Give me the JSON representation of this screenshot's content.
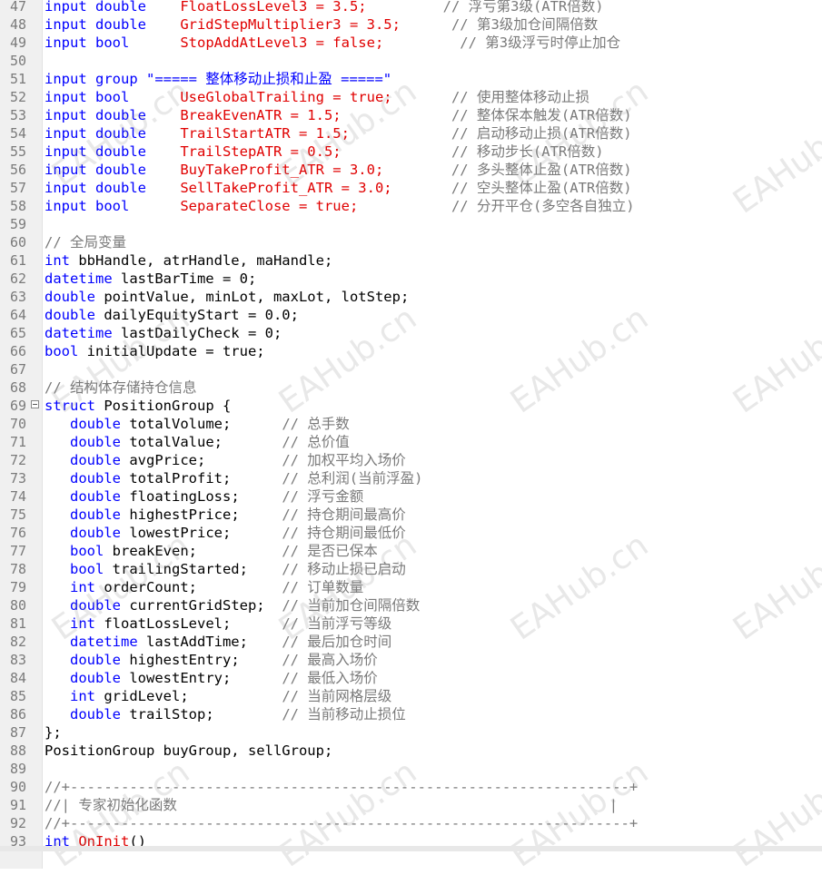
{
  "lines": [
    {
      "n": "47",
      "t": [
        [
          "kw",
          "input double"
        ],
        [
          "",
          "    "
        ],
        [
          "red",
          "FloatLossLevel3"
        ],
        [
          "",
          ""
        ],
        [
          "red",
          " = 3.5;"
        ],
        [
          "",
          ""
        ],
        [
          "cm",
          "         // 浮亏第3级(ATR倍数)"
        ]
      ]
    },
    {
      "n": "48",
      "t": [
        [
          "kw",
          "input double"
        ],
        [
          "",
          "    "
        ],
        [
          "red",
          "GridStepMultiplier3 = 3.5;"
        ],
        [
          "cm",
          "      // 第3级加仓间隔倍数"
        ]
      ]
    },
    {
      "n": "49",
      "t": [
        [
          "kw",
          "input bool"
        ],
        [
          "",
          "      "
        ],
        [
          "red",
          "StopAddAtLevel3 = false;"
        ],
        [
          "cm",
          "         // 第3级浮亏时停止加仓"
        ]
      ]
    },
    {
      "n": "50",
      "t": []
    },
    {
      "n": "51",
      "t": [
        [
          "kw",
          "input group "
        ],
        [
          "str",
          "\"===== 整体移动止损和止盈 =====\""
        ]
      ]
    },
    {
      "n": "52",
      "t": [
        [
          "kw",
          "input bool"
        ],
        [
          "",
          "      "
        ],
        [
          "red",
          "UseGlobalTrailing = true;"
        ],
        [
          "cm",
          "       // 使用整体移动止损"
        ]
      ]
    },
    {
      "n": "53",
      "t": [
        [
          "kw",
          "input double"
        ],
        [
          "",
          "    "
        ],
        [
          "red",
          "BreakEvenATR = 1.5;"
        ],
        [
          "cm",
          "             // 整体保本触发(ATR倍数)"
        ]
      ]
    },
    {
      "n": "54",
      "t": [
        [
          "kw",
          "input double"
        ],
        [
          "",
          "    "
        ],
        [
          "red",
          "TrailStartATR = 1.5;"
        ],
        [
          "cm",
          "            // 启动移动止损(ATR倍数)"
        ]
      ]
    },
    {
      "n": "55",
      "t": [
        [
          "kw",
          "input double"
        ],
        [
          "",
          "    "
        ],
        [
          "red",
          "TrailStepATR = 0.5;"
        ],
        [
          "cm",
          "             // 移动步长(ATR倍数)"
        ]
      ]
    },
    {
      "n": "56",
      "t": [
        [
          "kw",
          "input double"
        ],
        [
          "",
          "    "
        ],
        [
          "red",
          "BuyTakeProfit_ATR = 3.0;"
        ],
        [
          "cm",
          "        // 多头整体止盈(ATR倍数)"
        ]
      ]
    },
    {
      "n": "57",
      "t": [
        [
          "kw",
          "input double"
        ],
        [
          "",
          "    "
        ],
        [
          "red",
          "SellTakeProfit_ATR = 3.0;"
        ],
        [
          "cm",
          "       // 空头整体止盈(ATR倍数)"
        ]
      ]
    },
    {
      "n": "58",
      "t": [
        [
          "kw",
          "input bool"
        ],
        [
          "",
          "      "
        ],
        [
          "red",
          "SeparateClose = true;"
        ],
        [
          "cm",
          "           // 分开平仓(多空各自独立)"
        ]
      ]
    },
    {
      "n": "59",
      "t": []
    },
    {
      "n": "60",
      "t": [
        [
          "cm",
          "// 全局变量"
        ]
      ]
    },
    {
      "n": "61",
      "t": [
        [
          "kw",
          "int"
        ],
        [
          "",
          " bbHandle, atrHandle, maHandle;"
        ]
      ]
    },
    {
      "n": "62",
      "t": [
        [
          "kw",
          "datetime"
        ],
        [
          "",
          " lastBarTime = 0;"
        ]
      ]
    },
    {
      "n": "63",
      "t": [
        [
          "kw",
          "double"
        ],
        [
          "",
          " pointValue, minLot, maxLot, lotStep;"
        ]
      ]
    },
    {
      "n": "64",
      "t": [
        [
          "kw",
          "double"
        ],
        [
          "",
          " dailyEquityStart = 0.0;"
        ]
      ]
    },
    {
      "n": "65",
      "t": [
        [
          "kw",
          "datetime"
        ],
        [
          "",
          " lastDailyCheck = 0;"
        ]
      ]
    },
    {
      "n": "66",
      "t": [
        [
          "kw",
          "bool"
        ],
        [
          "",
          " initialUpdate = true;"
        ]
      ]
    },
    {
      "n": "67",
      "t": []
    },
    {
      "n": "68",
      "t": [
        [
          "cm",
          "// 结构体存储持仓信息"
        ]
      ]
    },
    {
      "n": "69",
      "fold": true,
      "t": [
        [
          "kw",
          "struct"
        ],
        [
          "",
          " PositionGroup {"
        ]
      ]
    },
    {
      "n": "70",
      "t": [
        [
          "",
          "   "
        ],
        [
          "kw",
          "double"
        ],
        [
          "",
          " totalVolume;      "
        ],
        [
          "cm",
          "// 总手数"
        ]
      ]
    },
    {
      "n": "71",
      "t": [
        [
          "",
          "   "
        ],
        [
          "kw",
          "double"
        ],
        [
          "",
          " totalValue;       "
        ],
        [
          "cm",
          "// 总价值"
        ]
      ]
    },
    {
      "n": "72",
      "t": [
        [
          "",
          "   "
        ],
        [
          "kw",
          "double"
        ],
        [
          "",
          " avgPrice;         "
        ],
        [
          "cm",
          "// 加权平均入场价"
        ]
      ]
    },
    {
      "n": "73",
      "t": [
        [
          "",
          "   "
        ],
        [
          "kw",
          "double"
        ],
        [
          "",
          " totalProfit;      "
        ],
        [
          "cm",
          "// 总利润(当前浮盈)"
        ]
      ]
    },
    {
      "n": "74",
      "t": [
        [
          "",
          "   "
        ],
        [
          "kw",
          "double"
        ],
        [
          "",
          " floatingLoss;     "
        ],
        [
          "cm",
          "// 浮亏金额"
        ]
      ]
    },
    {
      "n": "75",
      "t": [
        [
          "",
          "   "
        ],
        [
          "kw",
          "double"
        ],
        [
          "",
          " highestPrice;     "
        ],
        [
          "cm",
          "// 持仓期间最高价"
        ]
      ]
    },
    {
      "n": "76",
      "t": [
        [
          "",
          "   "
        ],
        [
          "kw",
          "double"
        ],
        [
          "",
          " lowestPrice;      "
        ],
        [
          "cm",
          "// 持仓期间最低价"
        ]
      ]
    },
    {
      "n": "77",
      "t": [
        [
          "",
          "   "
        ],
        [
          "kw",
          "bool"
        ],
        [
          "",
          " breakEven;          "
        ],
        [
          "cm",
          "// 是否已保本"
        ]
      ]
    },
    {
      "n": "78",
      "t": [
        [
          "",
          "   "
        ],
        [
          "kw",
          "bool"
        ],
        [
          "",
          " trailingStarted;    "
        ],
        [
          "cm",
          "// 移动止损已启动"
        ]
      ]
    },
    {
      "n": "79",
      "t": [
        [
          "",
          "   "
        ],
        [
          "kw",
          "int"
        ],
        [
          "",
          " orderCount;          "
        ],
        [
          "cm",
          "// 订单数量"
        ]
      ]
    },
    {
      "n": "80",
      "t": [
        [
          "",
          "   "
        ],
        [
          "kw",
          "double"
        ],
        [
          "",
          " currentGridStep;  "
        ],
        [
          "cm",
          "// 当前加仓间隔倍数"
        ]
      ]
    },
    {
      "n": "81",
      "t": [
        [
          "",
          "   "
        ],
        [
          "kw",
          "int"
        ],
        [
          "",
          " floatLossLevel;      "
        ],
        [
          "cm",
          "// 当前浮亏等级"
        ]
      ]
    },
    {
      "n": "82",
      "t": [
        [
          "",
          "   "
        ],
        [
          "kw",
          "datetime"
        ],
        [
          "",
          " lastAddTime;    "
        ],
        [
          "cm",
          "// 最后加仓时间"
        ]
      ]
    },
    {
      "n": "83",
      "t": [
        [
          "",
          "   "
        ],
        [
          "kw",
          "double"
        ],
        [
          "",
          " highestEntry;     "
        ],
        [
          "cm",
          "// 最高入场价"
        ]
      ]
    },
    {
      "n": "84",
      "t": [
        [
          "",
          "   "
        ],
        [
          "kw",
          "double"
        ],
        [
          "",
          " lowestEntry;      "
        ],
        [
          "cm",
          "// 最低入场价"
        ]
      ]
    },
    {
      "n": "85",
      "t": [
        [
          "",
          "   "
        ],
        [
          "kw",
          "int"
        ],
        [
          "",
          " gridLevel;           "
        ],
        [
          "cm",
          "// 当前网格层级"
        ]
      ]
    },
    {
      "n": "86",
      "t": [
        [
          "",
          "   "
        ],
        [
          "kw",
          "double"
        ],
        [
          "",
          " trailStop;        "
        ],
        [
          "cm",
          "// 当前移动止损位"
        ]
      ]
    },
    {
      "n": "87",
      "t": [
        [
          "",
          "};"
        ]
      ]
    },
    {
      "n": "88",
      "t": [
        [
          "",
          "PositionGroup buyGroup, sellGroup;"
        ]
      ]
    },
    {
      "n": "89",
      "t": []
    },
    {
      "n": "90",
      "t": [
        [
          "cm",
          "//+------------------------------------------------------------------+"
        ]
      ]
    },
    {
      "n": "91",
      "t": [
        [
          "cm",
          "//| 专家初始化函数                                                   |"
        ]
      ]
    },
    {
      "n": "92",
      "t": [
        [
          "cm",
          "//+------------------------------------------------------------------+"
        ]
      ]
    },
    {
      "n": "93",
      "t": [
        [
          "kw",
          "int"
        ],
        [
          "",
          " "
        ],
        [
          "red",
          "OnInit"
        ],
        [
          "",
          "()"
        ]
      ]
    }
  ],
  "watermarks": [
    "EAHub.cn",
    "EAHub"
  ]
}
